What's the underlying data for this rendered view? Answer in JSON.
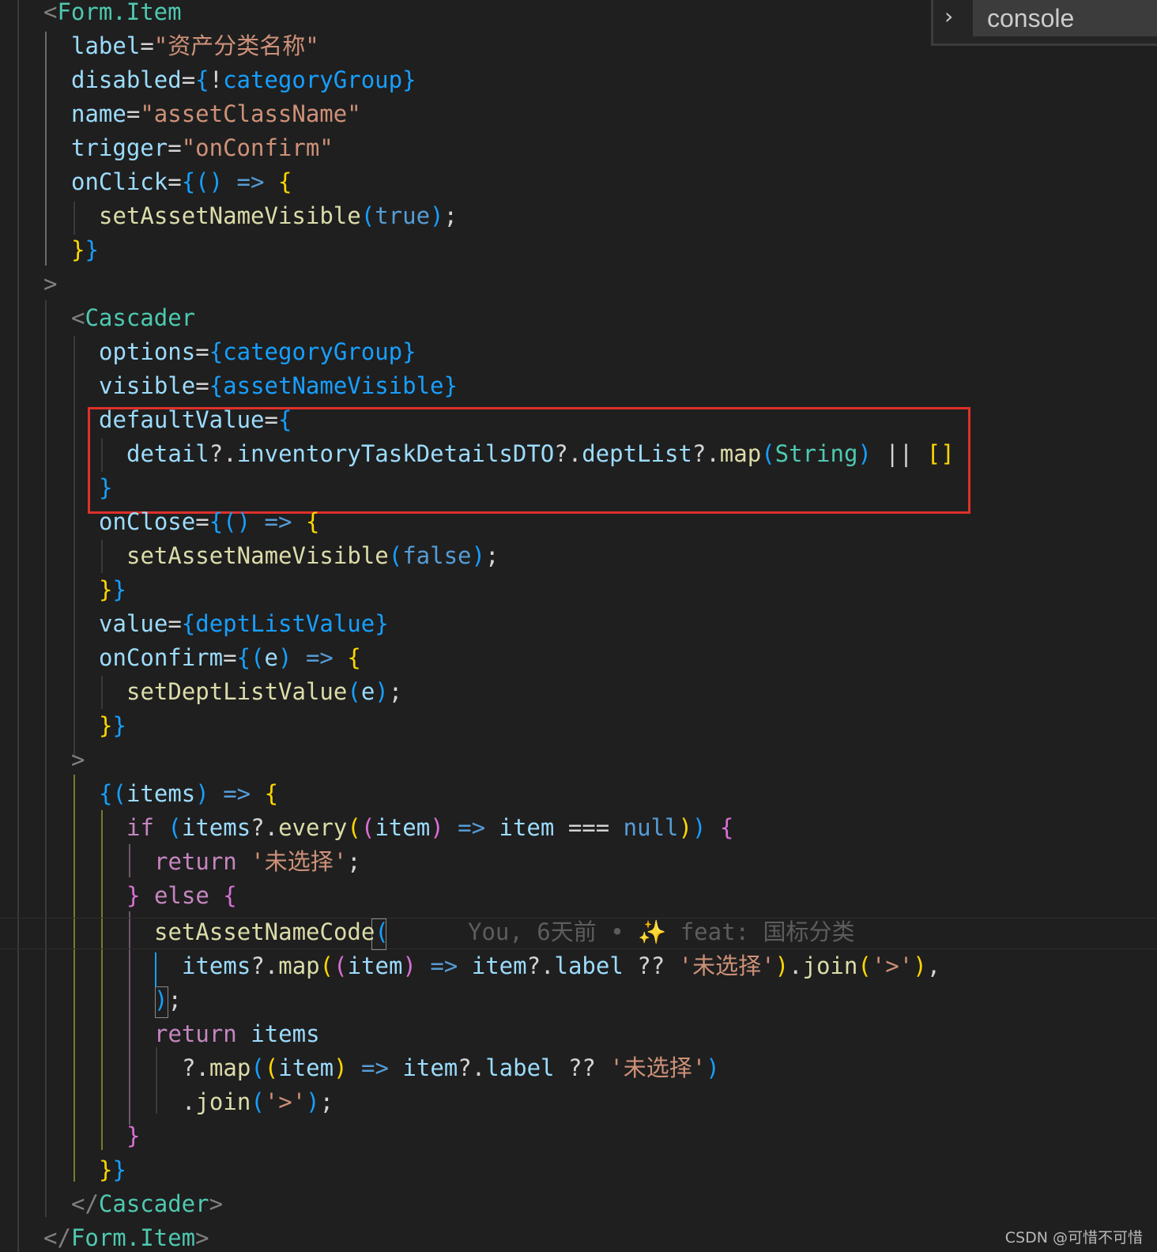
{
  "find_widget": {
    "query": "console",
    "toggle_icon": "chevron-right-icon"
  },
  "colors": {
    "tag_bracket": "#808080",
    "component": "#4ec9b0",
    "attribute": "#9cdcfe",
    "string": "#ce9178",
    "brace_blue": "#179fff",
    "brace_yellow": "#ffd700",
    "brace_pink": "#da70d6",
    "function": "#dcdcaa",
    "keyword_blue": "#569cd6",
    "keyword_control": "#c586c0",
    "arrow": "#569cd6",
    "plain": "#d4d4d4",
    "variable": "#9cdcfe",
    "highlight_box": "#e0302a",
    "blame_text": "#5d5d5d"
  },
  "code": {
    "l01": [
      "<",
      "Form.Item"
    ],
    "l02": [
      "label",
      "=",
      "\"资产分类名称\""
    ],
    "l03": [
      "disabled",
      "=",
      "{",
      "!",
      "categoryGroup",
      "}"
    ],
    "l04": [
      "name",
      "=",
      "\"assetClassName\""
    ],
    "l05": [
      "trigger",
      "=",
      "\"onConfirm\""
    ],
    "l06": [
      "onClick",
      "=",
      "{",
      "()",
      " ",
      "=>",
      " ",
      "{"
    ],
    "l07": [
      "setAssetNameVisible",
      "(",
      "true",
      ")",
      ";"
    ],
    "l08": [
      "}",
      "}"
    ],
    "l09": [
      ">"
    ],
    "l10": [
      "<",
      "Cascader"
    ],
    "l11": [
      "options",
      "=",
      "{",
      "categoryGroup",
      "}"
    ],
    "l12": [
      "visible",
      "=",
      "{",
      "assetNameVisible",
      "}"
    ],
    "l13": [
      "defaultValue",
      "=",
      "{"
    ],
    "l14": [
      "detail",
      "?.",
      "inventoryTaskDetailsDTO",
      "?.",
      "deptList",
      "?.",
      "map",
      "(",
      "String",
      ")",
      " || ",
      "[]"
    ],
    "l15": [
      "}"
    ],
    "l16": [
      "onClose",
      "=",
      "{",
      "()",
      " ",
      "=>",
      " ",
      "{"
    ],
    "l17": [
      "setAssetNameVisible",
      "(",
      "false",
      ")",
      ";"
    ],
    "l18": [
      "}",
      "}"
    ],
    "l19": [
      "value",
      "=",
      "{",
      "deptListValue",
      "}"
    ],
    "l20": [
      "onConfirm",
      "=",
      "{",
      "(",
      "e",
      ")",
      " ",
      "=>",
      " ",
      "{"
    ],
    "l21": [
      "setDeptListValue",
      "(",
      "e",
      ")",
      ";"
    ],
    "l22": [
      "}",
      "}"
    ],
    "l23": [
      ">"
    ],
    "l24": [
      "{",
      "(",
      "items",
      ")",
      " ",
      "=>",
      " ",
      "{"
    ],
    "l25": [
      "if",
      " ",
      "(",
      "items",
      "?.",
      "every",
      "(",
      "(",
      "item",
      ")",
      " ",
      "=>",
      " ",
      "item",
      " === ",
      "null",
      ")",
      ")",
      " ",
      "{"
    ],
    "l26": [
      "return",
      " ",
      "'未选择'",
      ";"
    ],
    "l27": [
      "}",
      " ",
      "else",
      " ",
      "{"
    ],
    "l28": [
      "setAssetNameCode",
      "("
    ],
    "l29": [
      "items",
      "?.",
      "map",
      "(",
      "(",
      "item",
      ")",
      " ",
      "=>",
      " ",
      "item",
      "?.",
      "label",
      " ?? ",
      "'未选择'",
      ")",
      ".",
      "join",
      "(",
      "'>'",
      ")",
      ","
    ],
    "l30": [
      ")",
      ";"
    ],
    "l31": [
      "return",
      " ",
      "items"
    ],
    "l32": [
      "?.",
      "map",
      "(",
      "(",
      "item",
      ")",
      " ",
      "=>",
      " ",
      "item",
      "?.",
      "label",
      " ?? ",
      "'未选择'",
      ")"
    ],
    "l33": [
      ".",
      "join",
      "(",
      "'>'",
      ")",
      ";"
    ],
    "l34": [
      "}"
    ],
    "l35": [
      "}",
      "}"
    ],
    "l36": [
      "</",
      "Cascader",
      ">"
    ],
    "l37": [
      "</",
      "Form.Item",
      ">"
    ]
  },
  "blame": "You, 6天前 • ✨ feat: 国标分类",
  "watermark": "CSDN @可惜不可惜"
}
